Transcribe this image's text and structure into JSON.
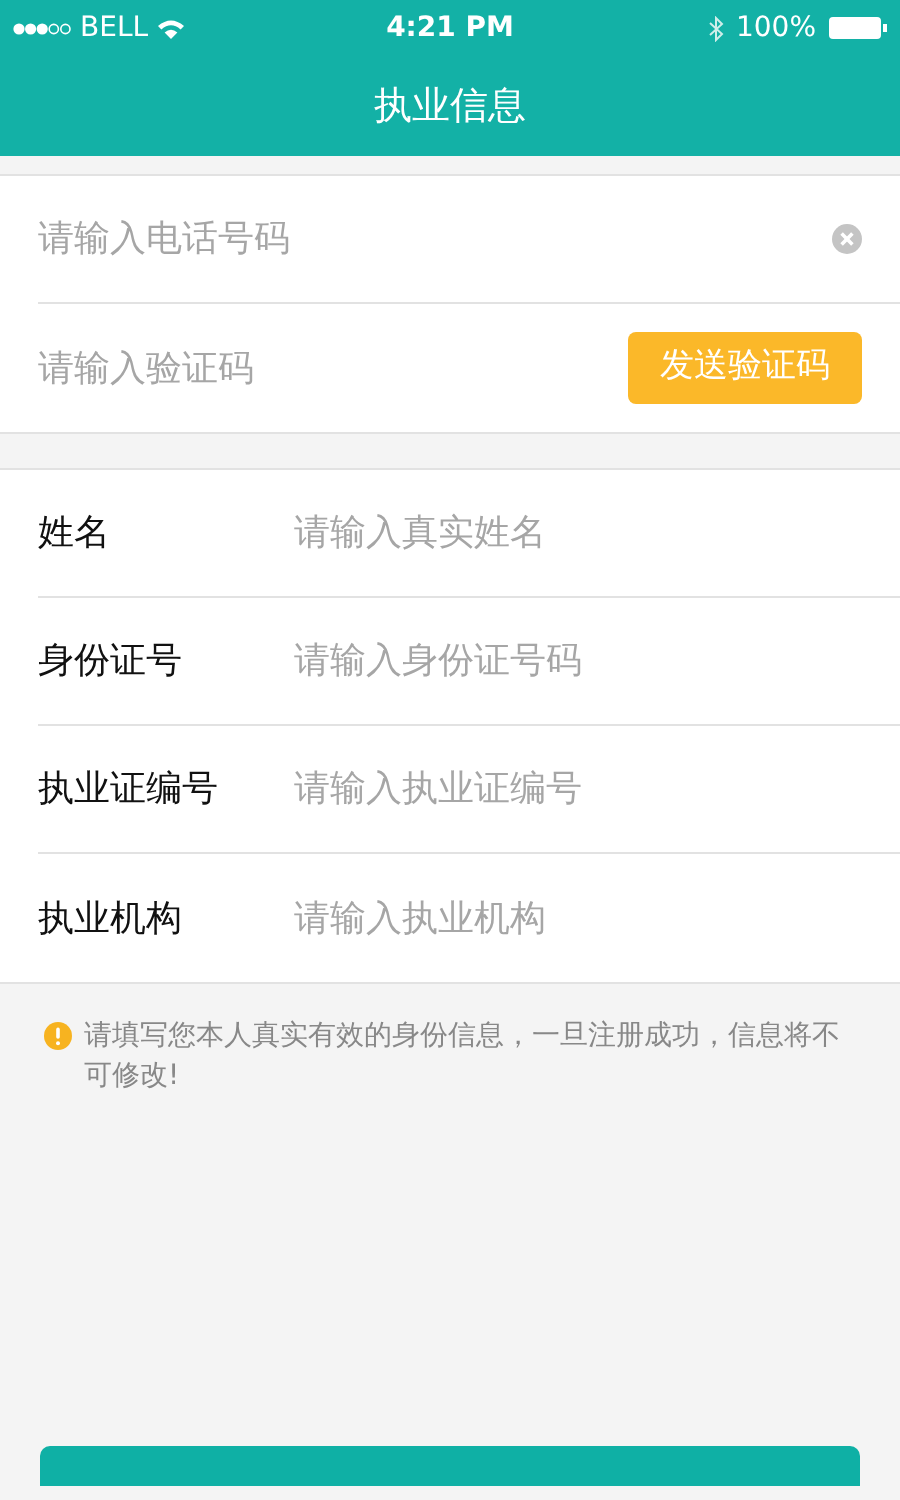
{
  "status_bar": {
    "carrier": "BELL",
    "time": "4:21 PM",
    "battery": "100%"
  },
  "nav": {
    "title": "执业信息"
  },
  "verify": {
    "phone": {
      "placeholder": "请输入电话号码"
    },
    "code": {
      "placeholder": "请输入验证码"
    },
    "send_button": "发送验证码"
  },
  "fields": [
    {
      "label": "姓名",
      "placeholder": "请输入真实姓名"
    },
    {
      "label": "身份证号",
      "placeholder": "请输入身份证号码"
    },
    {
      "label": "执业证编号",
      "placeholder": "请输入执业证编号"
    },
    {
      "label": "执业机构",
      "placeholder": "请输入执业机构"
    }
  ],
  "notice": "请填写您本人真实有效的身份信息，一旦注册成功，信息将不可修改!"
}
